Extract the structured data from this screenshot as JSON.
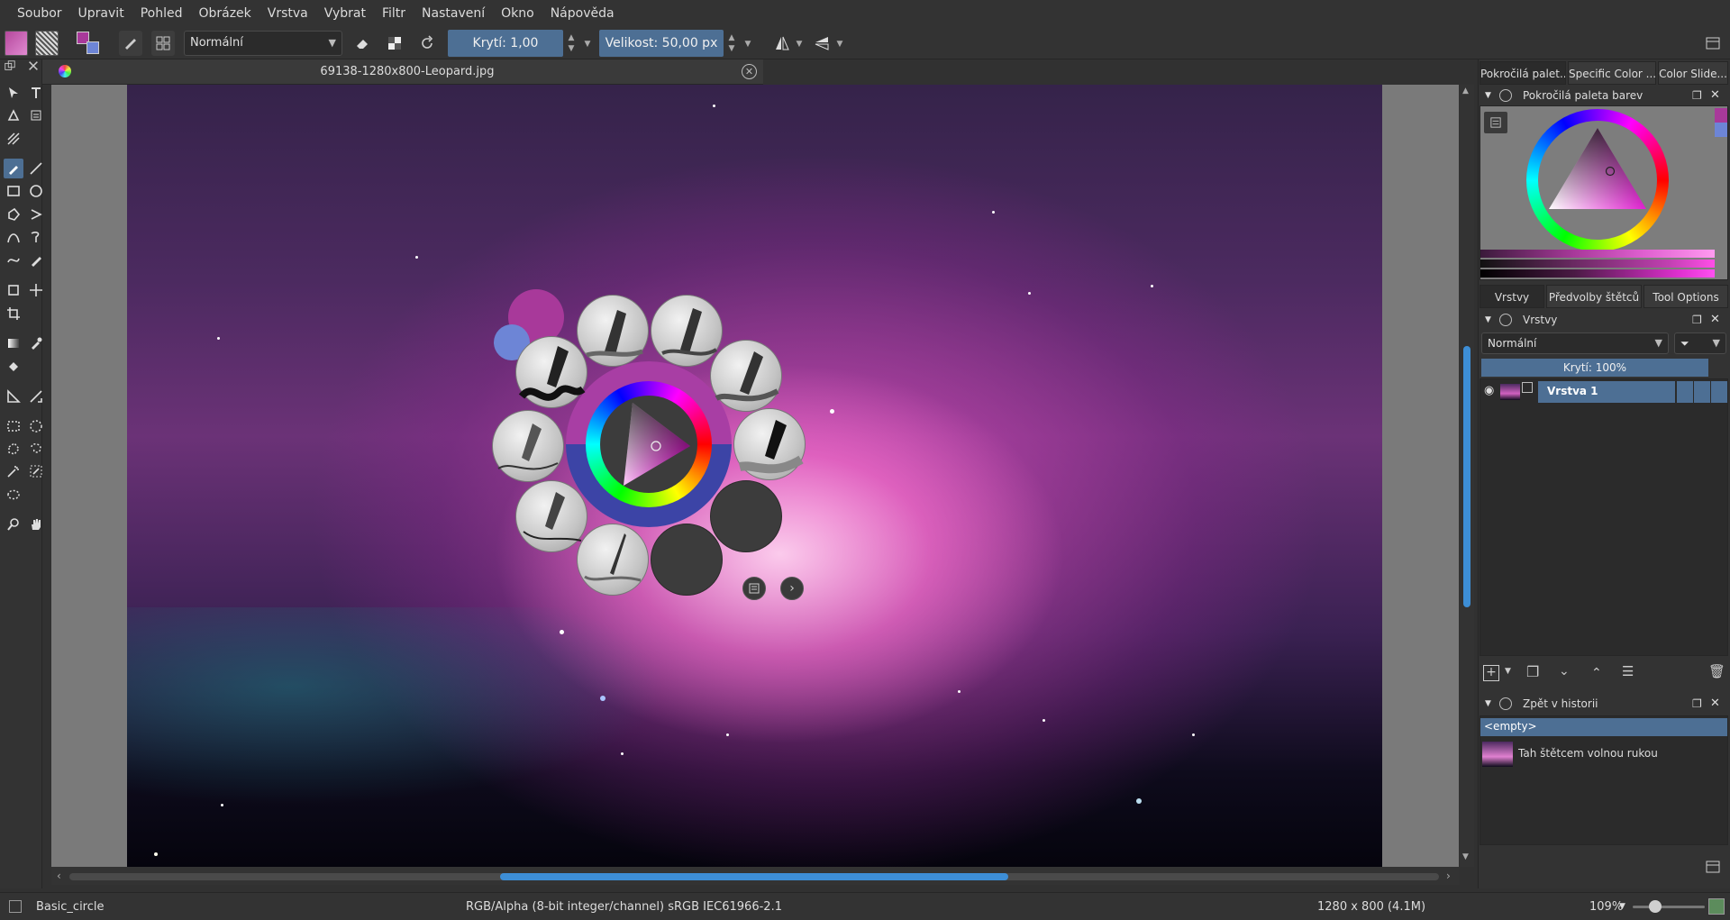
{
  "menubar": {
    "items": [
      "Soubor",
      "Upravit",
      "Pohled",
      "Obrázek",
      "Vrstva",
      "Vybrat",
      "Filtr",
      "Nastavení",
      "Okno",
      "Nápověda"
    ]
  },
  "toolbar": {
    "blend_mode": "Normální",
    "opacity_label": "Krytí:",
    "opacity_value": "1,00",
    "size_label": "Velikost:",
    "size_value": "50,00 px"
  },
  "document": {
    "tab_title": "69138-1280x800-Leopard.jpg"
  },
  "right_dock": {
    "top_tabs": [
      "Pokročilá palet...",
      "Specific Color ...",
      "Color Slide..."
    ],
    "color_panel_title": "Pokročilá paleta barev",
    "middle_tabs": [
      "Vrstvy",
      "Předvolby štětců",
      "Tool Options"
    ],
    "layers_title": "Vrstvy",
    "layers_blend_mode": "Normální",
    "layers_opacity_label": "Krytí:",
    "layers_opacity_value": "100%",
    "layer_name": "Vrstva 1",
    "history_title": "Zpět v historii",
    "history_items": [
      "<empty>",
      "Tah štětcem volnou rukou"
    ]
  },
  "statusbar": {
    "brush_preset": "Basic_circle",
    "color_space": "RGB/Alpha (8-bit integer/channel)  sRGB IEC61966-2.1",
    "image_size": "1280 x 800 (4.1M)",
    "zoom": "109%"
  },
  "colors": {
    "accent": "#4d6f94",
    "foreground_color": "#a8399a",
    "background_color": "#6d85d6",
    "scroll_thumb": "#3d8ed6"
  }
}
